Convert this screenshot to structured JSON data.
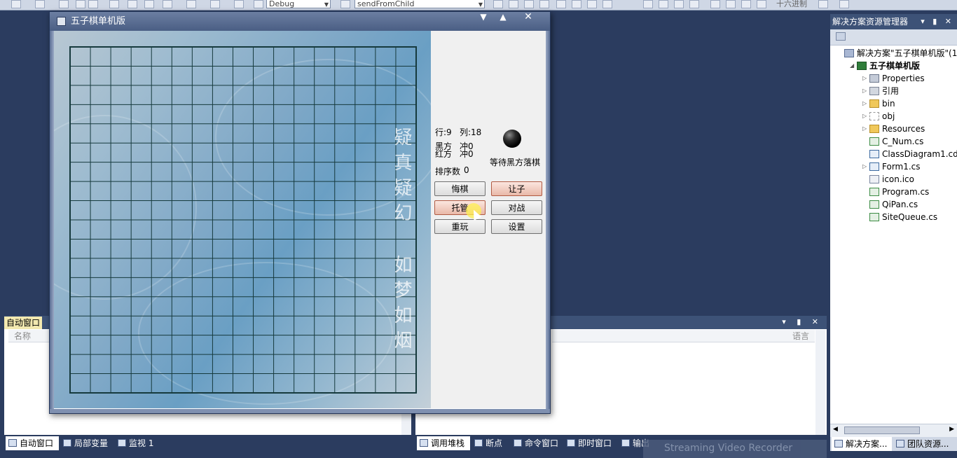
{
  "toolbar": {
    "config_combo": "Debug",
    "target_combo": "sendFromChild",
    "hex_label": "十六进制"
  },
  "solution_explorer": {
    "title": "解决方案资源管理器",
    "items": [
      {
        "label": "解决方案\"五子棋单机版\"(1",
        "icon": "solution-icon",
        "expander": ""
      },
      {
        "label": "五子棋单机版",
        "icon": "project-icon",
        "expander": "◢"
      },
      {
        "label": "Properties",
        "icon": "properties-icon",
        "expander": "▷"
      },
      {
        "label": "引用",
        "icon": "references-icon",
        "expander": "▷"
      },
      {
        "label": "bin",
        "icon": "folder-icon",
        "expander": "▷"
      },
      {
        "label": "obj",
        "icon": "folder-icon",
        "expander": "▷"
      },
      {
        "label": "Resources",
        "icon": "folder-icon",
        "expander": "▷"
      },
      {
        "label": "C_Num.cs",
        "icon": "csharp-file-icon",
        "expander": ""
      },
      {
        "label": "ClassDiagram1.cd",
        "icon": "class-diagram-icon",
        "expander": ""
      },
      {
        "label": "Form1.cs",
        "icon": "form-file-icon",
        "expander": "▷"
      },
      {
        "label": "icon.ico",
        "icon": "ico-file-icon",
        "expander": ""
      },
      {
        "label": "Program.cs",
        "icon": "csharp-file-icon",
        "expander": ""
      },
      {
        "label": "QiPan.cs",
        "icon": "csharp-file-icon",
        "expander": ""
      },
      {
        "label": "SiteQueue.cs",
        "icon": "csharp-file-icon",
        "expander": ""
      }
    ],
    "bottom_tabs": [
      "解决方案...",
      "团队资源..."
    ]
  },
  "auto_window": {
    "title": "自动窗口",
    "column_name": "名称"
  },
  "right_panel": {
    "column_lang": "语言"
  },
  "bottom_left_tabs": [
    "自动窗口",
    "局部变量",
    "监视 1"
  ],
  "bottom_mid_tabs": [
    "调用堆栈",
    "断点",
    "命令窗口",
    "即时窗口",
    "输出"
  ],
  "recorder": "Streaming Video Recorder",
  "game": {
    "title": "五子棋单机版",
    "board": {
      "rows": 18,
      "cols": 17
    },
    "poem_left": "疑真疑幻",
    "poem_right": "如梦如烟",
    "row_label": "行:9",
    "col_label": "列:18",
    "black_label": "黑方",
    "black_value": "冲0",
    "red_label": "红方",
    "red_value": "冲0",
    "move_count_label": "排序数",
    "move_count": "0",
    "status": "等待黑方落棋",
    "buttons": {
      "undo": "悔棋",
      "handicap": "让子",
      "auto": "托管",
      "versus": "对战",
      "replay": "重玩",
      "settings": "设置"
    }
  }
}
